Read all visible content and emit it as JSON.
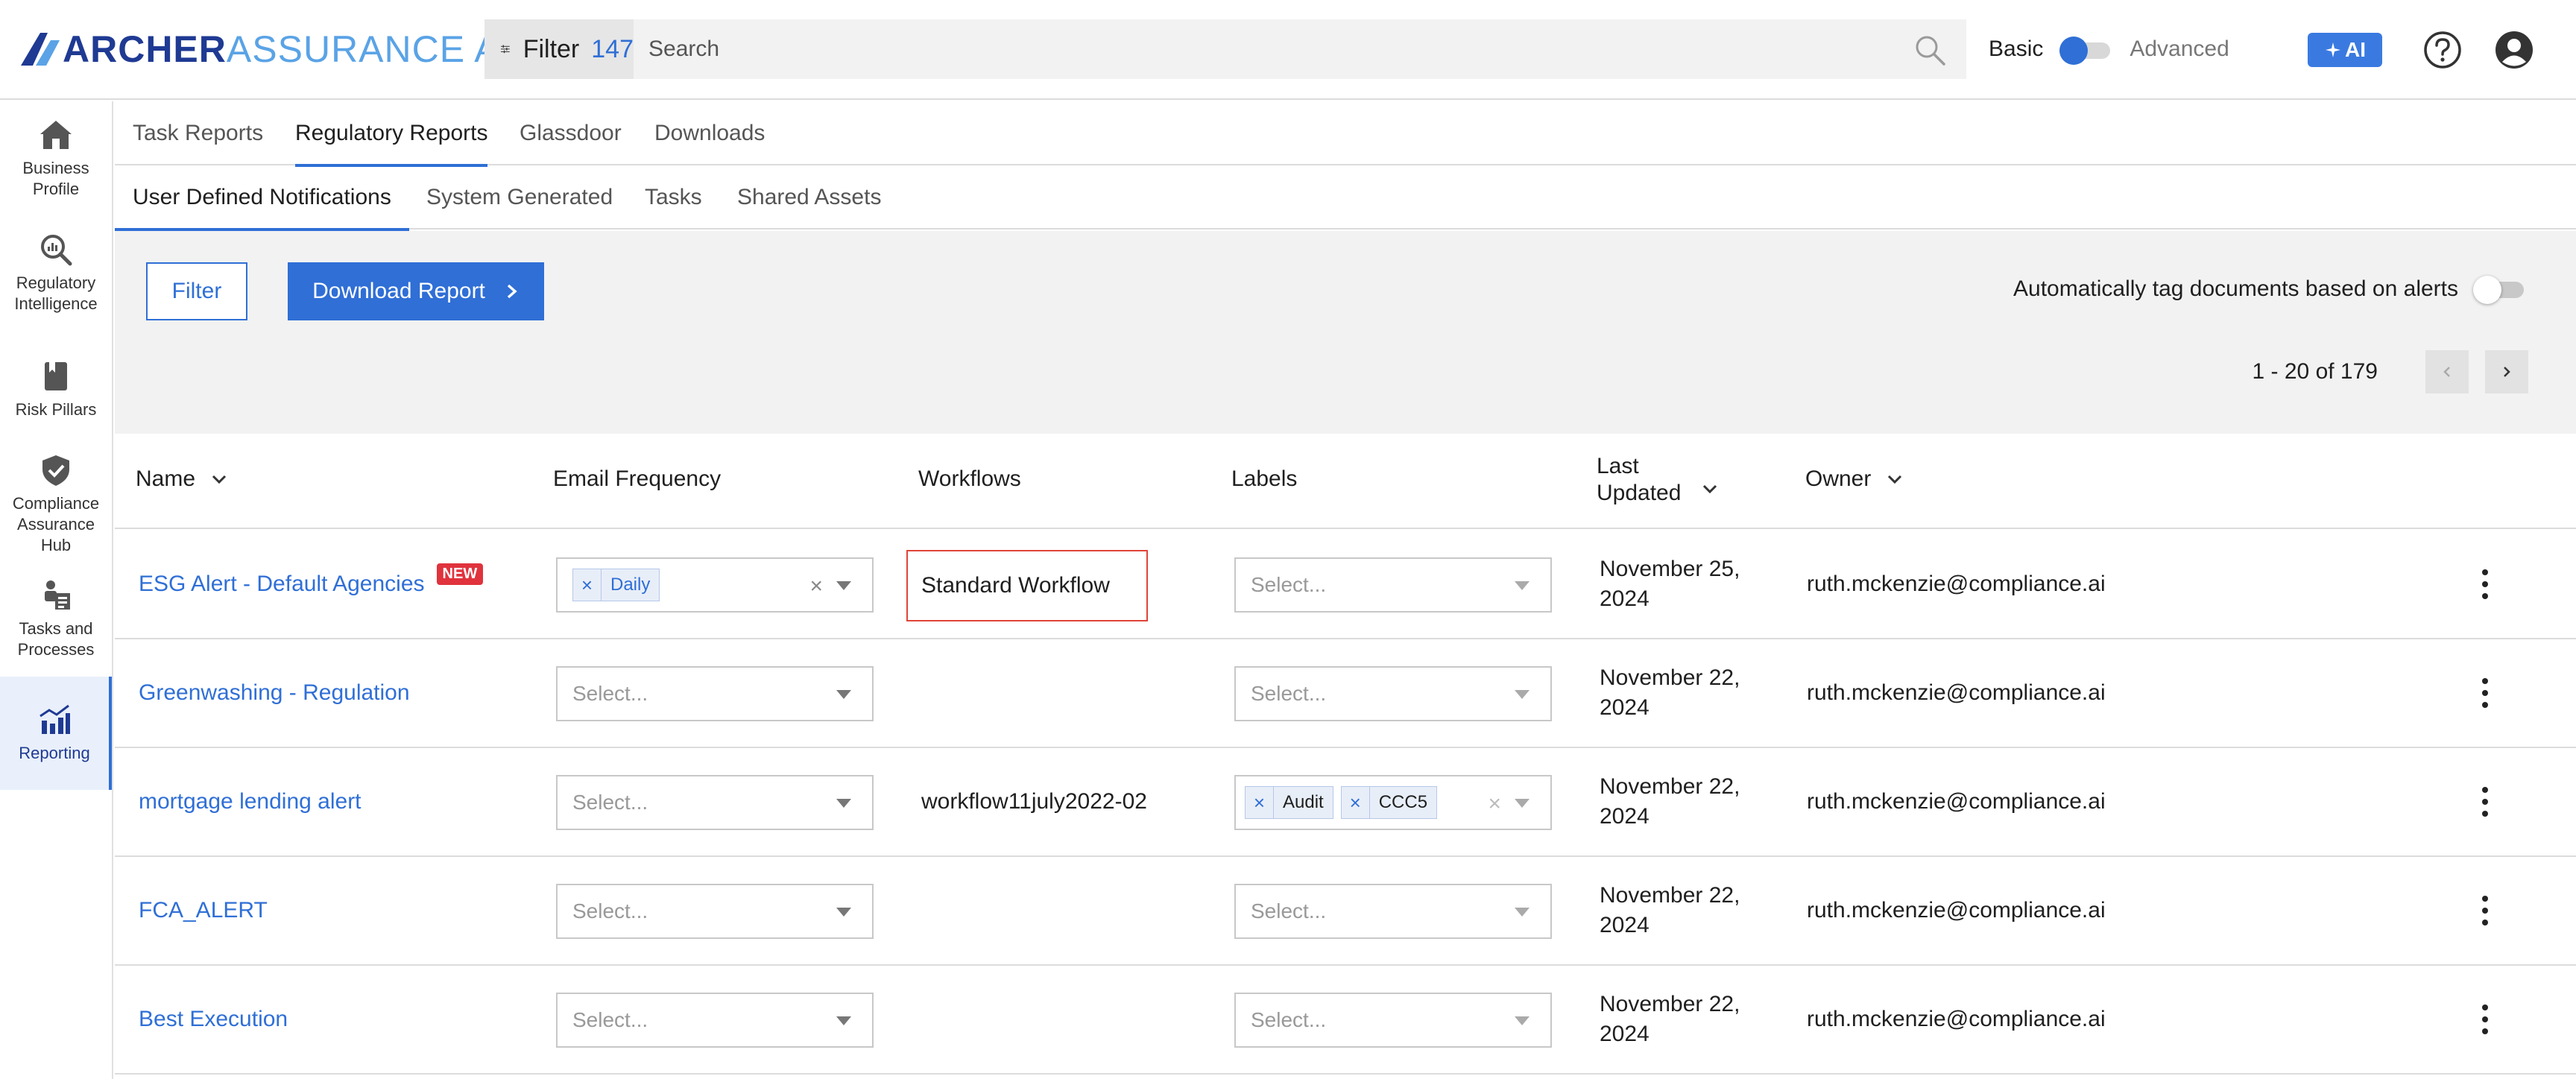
{
  "brand": {
    "word1": "ARCHER",
    "word2": "ASSURANCE AI",
    "accent": "#2f6fd6",
    "logo_dark": "#1f3a93",
    "logo_light": "#5aa3e6"
  },
  "header": {
    "filter_label": "Filter",
    "filter_count": "147",
    "search_placeholder": "Search",
    "mode_basic": "Basic",
    "mode_advanced": "Advanced",
    "ai_label": "AI"
  },
  "sidebar": {
    "items": [
      {
        "label": "Business Profile",
        "icon": "house-icon"
      },
      {
        "label": "Regulatory Intelligence",
        "icon": "search-analytics-icon"
      },
      {
        "label": "Risk Pillars",
        "icon": "book-icon"
      },
      {
        "label": "Compliance Assurance Hub",
        "icon": "shield-check-icon"
      },
      {
        "label": "Tasks and Processes",
        "icon": "tasks-icon"
      },
      {
        "label": "Reporting",
        "icon": "chart-icon",
        "active": true
      }
    ]
  },
  "tabs": {
    "primary": [
      "Task Reports",
      "Regulatory Reports",
      "Glassdoor",
      "Downloads"
    ],
    "primary_active": "Regulatory Reports",
    "secondary": [
      "User Defined Notifications",
      "System Generated",
      "Tasks",
      "Shared Assets"
    ],
    "secondary_active": "User Defined Notifications"
  },
  "actions": {
    "filter_button": "Filter",
    "download_button": "Download Report",
    "auto_tag_label": "Automatically tag documents based on alerts",
    "pagination": "1 - 20 of 179"
  },
  "table": {
    "columns": [
      "Name",
      "Email Frequency",
      "Workflows",
      "Labels",
      "Last Updated",
      "Owner"
    ],
    "select_placeholder": "Select...",
    "new_badge": "NEW",
    "rows": [
      {
        "name": "ESG Alert - Default Agencies",
        "is_new": true,
        "email_frequency": [
          "Daily"
        ],
        "workflow": "Standard Workflow",
        "labels": [],
        "date_line1": "November 25,",
        "date_line2": "2024",
        "owner": "ruth.mckenzie@compliance.ai"
      },
      {
        "name": "Greenwashing - Regulation",
        "is_new": false,
        "email_frequency": [],
        "workflow": "",
        "labels": [],
        "date_line1": "November 22,",
        "date_line2": "2024",
        "owner": "ruth.mckenzie@compliance.ai"
      },
      {
        "name": "mortgage lending alert",
        "is_new": false,
        "email_frequency": [],
        "workflow": "workflow11july2022-02",
        "labels": [
          "Audit",
          "CCC5"
        ],
        "date_line1": "November 22,",
        "date_line2": "2024",
        "owner": "ruth.mckenzie@compliance.ai"
      },
      {
        "name": "FCA_ALERT",
        "is_new": false,
        "email_frequency": [],
        "workflow": "",
        "labels": [],
        "date_line1": "November 22,",
        "date_line2": "2024",
        "owner": "ruth.mckenzie@compliance.ai"
      },
      {
        "name": "Best Execution",
        "is_new": false,
        "email_frequency": [],
        "workflow": "",
        "labels": [],
        "date_line1": "November 22,",
        "date_line2": "2024",
        "owner": "ruth.mckenzie@compliance.ai"
      }
    ]
  }
}
